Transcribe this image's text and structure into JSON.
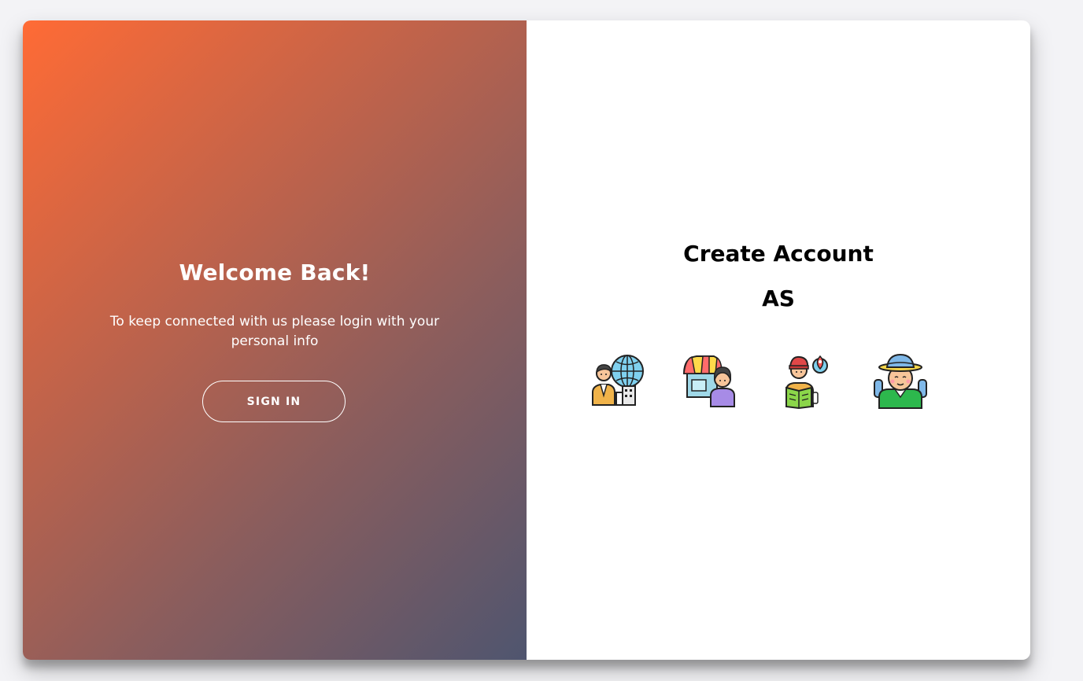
{
  "overlay": {
    "title": "Welcome Back!",
    "text": "To keep connected with us please login with your personal info",
    "signin_label": "SIGN IN"
  },
  "signup": {
    "title": "Create Account",
    "subtitle": "AS",
    "roles": [
      {
        "icon": "businessman-globe-icon"
      },
      {
        "icon": "shop-owner-icon"
      },
      {
        "icon": "tourist-map-icon"
      },
      {
        "icon": "backpacker-icon"
      }
    ]
  },
  "colors": {
    "gradient_start": "#ff6b35",
    "gradient_end": "#4f556f",
    "background": "#f3f3f6"
  }
}
